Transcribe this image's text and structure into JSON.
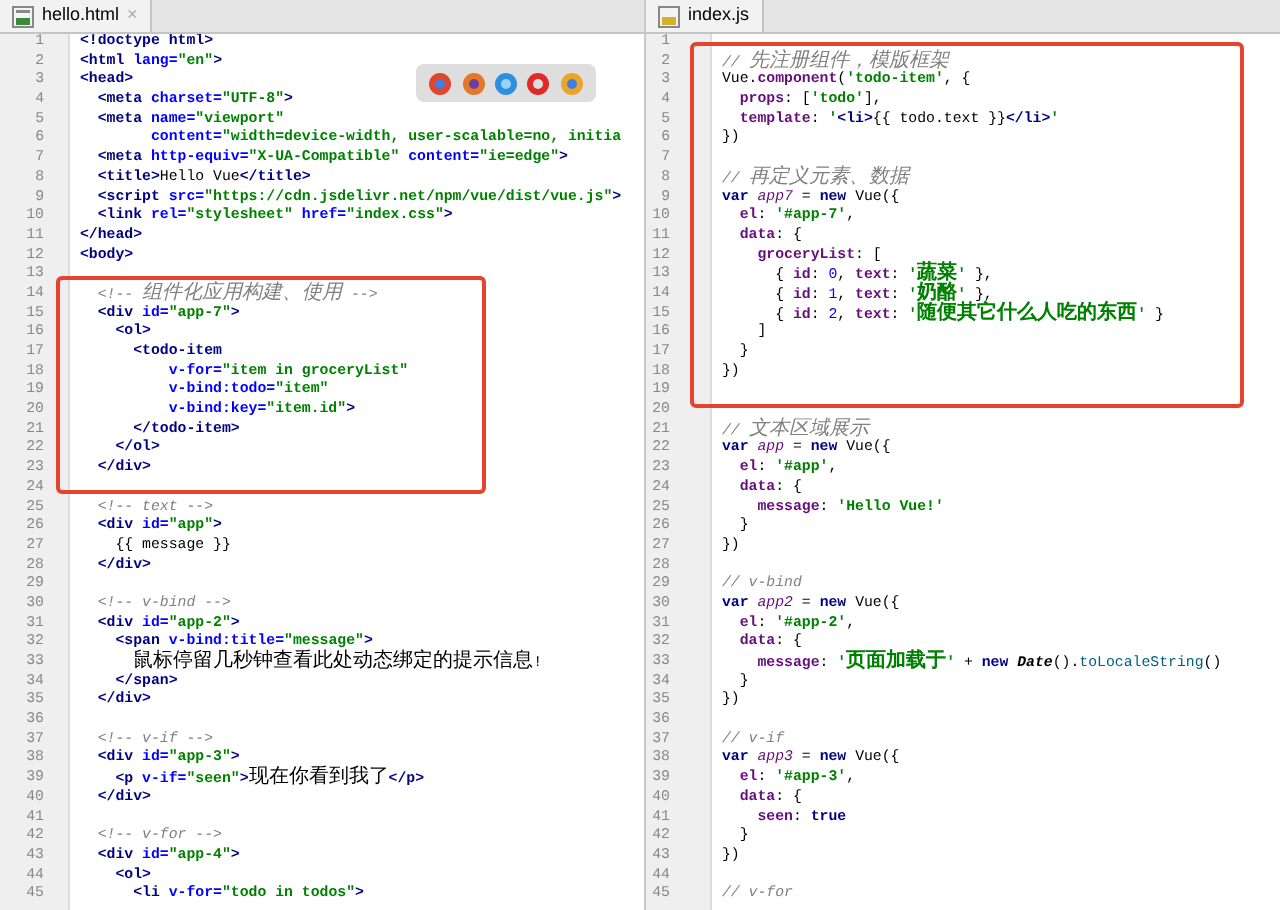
{
  "panes": [
    {
      "tab": {
        "kind": "html",
        "label": "hello.html",
        "close": "×"
      },
      "lines": [
        {
          "n": "1",
          "t": [
            {
              "kind": "tag",
              "text": "<!doctype html>"
            }
          ]
        },
        {
          "n": "2",
          "t": [
            {
              "kind": "tag",
              "text": "<html "
            },
            {
              "kind": "attr",
              "text": "lang="
            },
            {
              "kind": "str",
              "text": "\"en\""
            },
            {
              "kind": "tag",
              "text": ">"
            }
          ]
        },
        {
          "n": "3",
          "t": [
            {
              "kind": "tag",
              "text": "<head>"
            }
          ]
        },
        {
          "n": "4",
          "t": [
            {
              "kind": "tag",
              "text": "  <meta "
            },
            {
              "kind": "attr",
              "text": "charset="
            },
            {
              "kind": "str",
              "text": "\"UTF-8\""
            },
            {
              "kind": "tag",
              "text": ">"
            }
          ]
        },
        {
          "n": "5",
          "t": [
            {
              "kind": "tag",
              "text": "  <meta "
            },
            {
              "kind": "attr",
              "text": "name="
            },
            {
              "kind": "str",
              "text": "\"viewport\""
            }
          ]
        },
        {
          "n": "6",
          "t": [
            {
              "kind": "attr",
              "text": "        content="
            },
            {
              "kind": "str",
              "text": "\"width=device-width, user-scalable=no, initia"
            }
          ]
        },
        {
          "n": "7",
          "t": [
            {
              "kind": "tag",
              "text": "  <meta "
            },
            {
              "kind": "attr",
              "text": "http-equiv="
            },
            {
              "kind": "str",
              "text": "\"X-UA-Compatible\""
            },
            {
              "kind": "attr",
              "text": " content="
            },
            {
              "kind": "str",
              "text": "\"ie=edge\""
            },
            {
              "kind": "tag",
              "text": ">"
            }
          ]
        },
        {
          "n": "8",
          "t": [
            {
              "kind": "tag",
              "text": "  <title>"
            },
            {
              "kind": "plain",
              "text": "Hello Vue"
            },
            {
              "kind": "tag",
              "text": "</title>"
            }
          ]
        },
        {
          "n": "9",
          "t": [
            {
              "kind": "tag",
              "text": "  <script "
            },
            {
              "kind": "attr",
              "text": "src="
            },
            {
              "kind": "str",
              "text": "\"https://cdn.jsdelivr.net/npm/vue/dist/vue.js\""
            },
            {
              "kind": "tag",
              "text": ">"
            }
          ]
        },
        {
          "n": "10",
          "t": [
            {
              "kind": "tag",
              "text": "  <link "
            },
            {
              "kind": "attr",
              "text": "rel="
            },
            {
              "kind": "str",
              "text": "\"stylesheet\""
            },
            {
              "kind": "attr",
              "text": " href="
            },
            {
              "kind": "str",
              "text": "\"index.css\""
            },
            {
              "kind": "tag",
              "text": ">"
            }
          ]
        },
        {
          "n": "11",
          "t": [
            {
              "kind": "tag",
              "text": "</head>"
            }
          ]
        },
        {
          "n": "12",
          "t": [
            {
              "kind": "tag",
              "text": "<body>"
            }
          ]
        },
        {
          "n": "13"
        },
        {
          "n": "14",
          "t": [
            {
              "kind": "comment",
              "text": "  <!-- 组件化应用构建、使用 -->"
            }
          ]
        },
        {
          "n": "15",
          "t": [
            {
              "kind": "tag",
              "text": "  <div "
            },
            {
              "kind": "attr",
              "text": "id="
            },
            {
              "kind": "str",
              "text": "\"app-7\""
            },
            {
              "kind": "tag",
              "text": ">"
            }
          ]
        },
        {
          "n": "16",
          "t": [
            {
              "kind": "tag",
              "text": "    <ol>"
            }
          ]
        },
        {
          "n": "17",
          "t": [
            {
              "kind": "tag",
              "text": "      <todo-item"
            }
          ]
        },
        {
          "n": "18",
          "t": [
            {
              "kind": "attr",
              "text": "          v-for="
            },
            {
              "kind": "str",
              "text": "\"item in groceryList\""
            }
          ]
        },
        {
          "n": "19",
          "t": [
            {
              "kind": "attr",
              "text": "          v-bind:todo="
            },
            {
              "kind": "str",
              "text": "\"item\""
            }
          ]
        },
        {
          "n": "20",
          "t": [
            {
              "kind": "attr",
              "text": "          v-bind:key="
            },
            {
              "kind": "str",
              "text": "\"item.id\""
            },
            {
              "kind": "tag",
              "text": ">"
            }
          ]
        },
        {
          "n": "21",
          "t": [
            {
              "kind": "tag",
              "text": "      </todo-item>"
            }
          ]
        },
        {
          "n": "22",
          "t": [
            {
              "kind": "tag",
              "text": "    </ol>"
            }
          ]
        },
        {
          "n": "23",
          "t": [
            {
              "kind": "tag",
              "text": "  </div>"
            }
          ]
        },
        {
          "n": "24"
        },
        {
          "n": "25",
          "t": [
            {
              "kind": "comment",
              "text": "  <!-- text -->"
            }
          ]
        },
        {
          "n": "26",
          "t": [
            {
              "kind": "tag",
              "text": "  <div "
            },
            {
              "kind": "attr",
              "text": "id="
            },
            {
              "kind": "str",
              "text": "\"app\""
            },
            {
              "kind": "tag",
              "text": ">"
            }
          ]
        },
        {
          "n": "27",
          "t": [
            {
              "kind": "plain",
              "text": "    {{ message }}"
            }
          ]
        },
        {
          "n": "28",
          "t": [
            {
              "kind": "tag",
              "text": "  </div>"
            }
          ]
        },
        {
          "n": "29"
        },
        {
          "n": "30",
          "t": [
            {
              "kind": "comment",
              "text": "  <!-- v-bind -->"
            }
          ]
        },
        {
          "n": "31",
          "t": [
            {
              "kind": "tag",
              "text": "  <div "
            },
            {
              "kind": "attr",
              "text": "id="
            },
            {
              "kind": "str",
              "text": "\"app-2\""
            },
            {
              "kind": "tag",
              "text": ">"
            }
          ]
        },
        {
          "n": "32",
          "t": [
            {
              "kind": "tag",
              "text": "    <span "
            },
            {
              "kind": "attr",
              "text": "v-bind:title="
            },
            {
              "kind": "str",
              "text": "\"message\""
            },
            {
              "kind": "tag",
              "text": ">"
            }
          ]
        },
        {
          "n": "33",
          "t": [
            {
              "kind": "plain",
              "text": "      鼠标停留几秒钟查看此处动态绑定的提示信息!"
            }
          ]
        },
        {
          "n": "34",
          "t": [
            {
              "kind": "tag",
              "text": "    </span>"
            }
          ]
        },
        {
          "n": "35",
          "t": [
            {
              "kind": "tag",
              "text": "  </div>"
            }
          ]
        },
        {
          "n": "36"
        },
        {
          "n": "37",
          "t": [
            {
              "kind": "comment",
              "text": "  <!-- v-if -->"
            }
          ]
        },
        {
          "n": "38",
          "t": [
            {
              "kind": "tag",
              "text": "  <div "
            },
            {
              "kind": "attr",
              "text": "id="
            },
            {
              "kind": "str",
              "text": "\"app-3\""
            },
            {
              "kind": "tag",
              "text": ">"
            }
          ]
        },
        {
          "n": "39",
          "t": [
            {
              "kind": "tag",
              "text": "    <p "
            },
            {
              "kind": "attr",
              "text": "v-if="
            },
            {
              "kind": "str",
              "text": "\"seen\""
            },
            {
              "kind": "tag",
              "text": ">"
            },
            {
              "kind": "plain",
              "text": "现在你看到我了"
            },
            {
              "kind": "tag",
              "text": "</p>"
            }
          ]
        },
        {
          "n": "40",
          "t": [
            {
              "kind": "tag",
              "text": "  </div>"
            }
          ]
        },
        {
          "n": "41"
        },
        {
          "n": "42",
          "t": [
            {
              "kind": "comment",
              "text": "  <!-- v-for -->"
            }
          ]
        },
        {
          "n": "43",
          "t": [
            {
              "kind": "tag",
              "text": "  <div "
            },
            {
              "kind": "attr",
              "text": "id="
            },
            {
              "kind": "str",
              "text": "\"app-4\""
            },
            {
              "kind": "tag",
              "text": ">"
            }
          ]
        },
        {
          "n": "44",
          "t": [
            {
              "kind": "tag",
              "text": "    <ol>"
            }
          ]
        },
        {
          "n": "45",
          "t": [
            {
              "kind": "tag",
              "text": "      <li "
            },
            {
              "kind": "attr",
              "text": "v-for="
            },
            {
              "kind": "str",
              "text": "\"todo in todos\""
            },
            {
              "kind": "tag",
              "text": ">"
            }
          ]
        }
      ]
    },
    {
      "tab": {
        "kind": "js",
        "label": "index.js"
      },
      "lines": [
        {
          "n": "1"
        },
        {
          "n": "2",
          "t": [
            {
              "kind": "comment",
              "text": "// 先注册组件，模版框架"
            }
          ]
        },
        {
          "n": "3",
          "t": [
            {
              "kind": "plain",
              "text": "Vue."
            },
            {
              "kind": "prop",
              "text": "component"
            },
            {
              "kind": "plain",
              "text": "("
            },
            {
              "kind": "str",
              "text": "'todo-item'"
            },
            {
              "kind": "plain",
              "text": ", {"
            }
          ]
        },
        {
          "n": "4",
          "t": [
            {
              "kind": "prop",
              "text": "  props"
            },
            {
              "kind": "plain",
              "text": ": ["
            },
            {
              "kind": "str",
              "text": "'todo'"
            },
            {
              "kind": "plain",
              "text": "],"
            }
          ]
        },
        {
          "n": "5",
          "t": [
            {
              "kind": "prop",
              "text": "  template"
            },
            {
              "kind": "plain",
              "text": ": "
            },
            {
              "kind": "str",
              "text": "'"
            },
            {
              "kind": "tag",
              "text": "<li>"
            },
            {
              "kind": "plain",
              "text": "{{ todo.text }}"
            },
            {
              "kind": "tag",
              "text": "</li>"
            },
            {
              "kind": "str",
              "text": "'"
            }
          ]
        },
        {
          "n": "6",
          "t": [
            {
              "kind": "plain",
              "text": "})"
            }
          ]
        },
        {
          "n": "7"
        },
        {
          "n": "8",
          "t": [
            {
              "kind": "comment",
              "text": "// 再定义元素、数据"
            }
          ]
        },
        {
          "n": "9",
          "t": [
            {
              "kind": "keyword",
              "text": "var "
            },
            {
              "kind": "var",
              "text": "app7"
            },
            {
              "kind": "plain",
              "text": " = "
            },
            {
              "kind": "keyword",
              "text": "new "
            },
            {
              "kind": "plain",
              "text": "Vue({"
            }
          ]
        },
        {
          "n": "10",
          "t": [
            {
              "kind": "prop",
              "text": "  el"
            },
            {
              "kind": "plain",
              "text": ": "
            },
            {
              "kind": "str",
              "text": "'#app-7'"
            },
            {
              "kind": "plain",
              "text": ","
            }
          ]
        },
        {
          "n": "11",
          "t": [
            {
              "kind": "prop",
              "text": "  data"
            },
            {
              "kind": "plain",
              "text": ": {"
            }
          ]
        },
        {
          "n": "12",
          "t": [
            {
              "kind": "prop",
              "text": "    groceryList"
            },
            {
              "kind": "plain",
              "text": ": ["
            }
          ]
        },
        {
          "n": "13",
          "t": [
            {
              "kind": "plain",
              "text": "      { "
            },
            {
              "kind": "prop",
              "text": "id"
            },
            {
              "kind": "plain",
              "text": ": "
            },
            {
              "kind": "num",
              "text": "0"
            },
            {
              "kind": "plain",
              "text": ", "
            },
            {
              "kind": "prop",
              "text": "text"
            },
            {
              "kind": "plain",
              "text": ": "
            },
            {
              "kind": "str",
              "text": "'蔬菜'"
            },
            {
              "kind": "plain",
              "text": " },"
            }
          ]
        },
        {
          "n": "14",
          "t": [
            {
              "kind": "plain",
              "text": "      { "
            },
            {
              "kind": "prop",
              "text": "id"
            },
            {
              "kind": "plain",
              "text": ": "
            },
            {
              "kind": "num",
              "text": "1"
            },
            {
              "kind": "plain",
              "text": ", "
            },
            {
              "kind": "prop",
              "text": "text"
            },
            {
              "kind": "plain",
              "text": ": "
            },
            {
              "kind": "str",
              "text": "'奶酪'"
            },
            {
              "kind": "plain",
              "text": " },"
            }
          ]
        },
        {
          "n": "15",
          "t": [
            {
              "kind": "plain",
              "text": "      { "
            },
            {
              "kind": "prop",
              "text": "id"
            },
            {
              "kind": "plain",
              "text": ": "
            },
            {
              "kind": "num",
              "text": "2"
            },
            {
              "kind": "plain",
              "text": ", "
            },
            {
              "kind": "prop",
              "text": "text"
            },
            {
              "kind": "plain",
              "text": ": "
            },
            {
              "kind": "str",
              "text": "'随便其它什么人吃的东西'"
            },
            {
              "kind": "plain",
              "text": " }"
            }
          ]
        },
        {
          "n": "16",
          "t": [
            {
              "kind": "plain",
              "text": "    ]"
            }
          ]
        },
        {
          "n": "17",
          "t": [
            {
              "kind": "plain",
              "text": "  }"
            }
          ]
        },
        {
          "n": "18",
          "t": [
            {
              "kind": "plain",
              "text": "})"
            }
          ]
        },
        {
          "n": "19"
        },
        {
          "n": "20"
        },
        {
          "n": "21",
          "t": [
            {
              "kind": "comment",
              "text": "// 文本区域展示"
            }
          ]
        },
        {
          "n": "22",
          "t": [
            {
              "kind": "keyword",
              "text": "var "
            },
            {
              "kind": "var",
              "text": "app"
            },
            {
              "kind": "plain",
              "text": " = "
            },
            {
              "kind": "keyword",
              "text": "new "
            },
            {
              "kind": "plain",
              "text": "Vue({"
            }
          ]
        },
        {
          "n": "23",
          "t": [
            {
              "kind": "prop",
              "text": "  el"
            },
            {
              "kind": "plain",
              "text": ": "
            },
            {
              "kind": "str",
              "text": "'#app'"
            },
            {
              "kind": "plain",
              "text": ","
            }
          ]
        },
        {
          "n": "24",
          "t": [
            {
              "kind": "prop",
              "text": "  data"
            },
            {
              "kind": "plain",
              "text": ": {"
            }
          ]
        },
        {
          "n": "25",
          "t": [
            {
              "kind": "prop",
              "text": "    message"
            },
            {
              "kind": "plain",
              "text": ": "
            },
            {
              "kind": "str",
              "text": "'Hello Vue!'"
            }
          ]
        },
        {
          "n": "26",
          "t": [
            {
              "kind": "plain",
              "text": "  }"
            }
          ]
        },
        {
          "n": "27",
          "t": [
            {
              "kind": "plain",
              "text": "})"
            }
          ]
        },
        {
          "n": "28"
        },
        {
          "n": "29",
          "t": [
            {
              "kind": "comment",
              "text": "// v-bind"
            }
          ]
        },
        {
          "n": "30",
          "t": [
            {
              "kind": "keyword",
              "text": "var "
            },
            {
              "kind": "var",
              "text": "app2"
            },
            {
              "kind": "plain",
              "text": " = "
            },
            {
              "kind": "keyword",
              "text": "new "
            },
            {
              "kind": "plain",
              "text": "Vue({"
            }
          ]
        },
        {
          "n": "31",
          "t": [
            {
              "kind": "prop",
              "text": "  el"
            },
            {
              "kind": "plain",
              "text": ": "
            },
            {
              "kind": "str",
              "text": "'#app-2'"
            },
            {
              "kind": "plain",
              "text": ","
            }
          ]
        },
        {
          "n": "32",
          "t": [
            {
              "kind": "prop",
              "text": "  data"
            },
            {
              "kind": "plain",
              "text": ": {"
            }
          ]
        },
        {
          "n": "33",
          "t": [
            {
              "kind": "prop",
              "text": "    message"
            },
            {
              "kind": "plain",
              "text": ": "
            },
            {
              "kind": "str",
              "text": "'页面加载于'"
            },
            {
              "kind": "plain",
              "text": " + "
            },
            {
              "kind": "keyword",
              "text": "new "
            },
            {
              "kind": "class",
              "text": "Date"
            },
            {
              "kind": "plain",
              "text": "()."
            },
            {
              "kind": "method",
              "text": "toLocaleString"
            },
            {
              "kind": "plain",
              "text": "()"
            }
          ]
        },
        {
          "n": "34",
          "t": [
            {
              "kind": "plain",
              "text": "  }"
            }
          ]
        },
        {
          "n": "35",
          "t": [
            {
              "kind": "plain",
              "text": "})"
            }
          ]
        },
        {
          "n": "36"
        },
        {
          "n": "37",
          "t": [
            {
              "kind": "comment",
              "text": "// v-if"
            }
          ]
        },
        {
          "n": "38",
          "t": [
            {
              "kind": "keyword",
              "text": "var "
            },
            {
              "kind": "var",
              "text": "app3"
            },
            {
              "kind": "plain",
              "text": " = "
            },
            {
              "kind": "keyword",
              "text": "new "
            },
            {
              "kind": "plain",
              "text": "Vue({"
            }
          ]
        },
        {
          "n": "39",
          "t": [
            {
              "kind": "prop",
              "text": "  el"
            },
            {
              "kind": "plain",
              "text": ": "
            },
            {
              "kind": "str",
              "text": "'#app-3'"
            },
            {
              "kind": "plain",
              "text": ","
            }
          ]
        },
        {
          "n": "40",
          "t": [
            {
              "kind": "prop",
              "text": "  data"
            },
            {
              "kind": "plain",
              "text": ": {"
            }
          ]
        },
        {
          "n": "41",
          "t": [
            {
              "kind": "prop",
              "text": "    seen"
            },
            {
              "kind": "plain",
              "text": ": "
            },
            {
              "kind": "keyword",
              "text": "true"
            }
          ]
        },
        {
          "n": "42",
          "t": [
            {
              "kind": "plain",
              "text": "  }"
            }
          ]
        },
        {
          "n": "43",
          "t": [
            {
              "kind": "plain",
              "text": "})"
            }
          ]
        },
        {
          "n": "44"
        },
        {
          "n": "45",
          "t": [
            {
              "kind": "comment",
              "text": "// v-for"
            }
          ]
        }
      ]
    }
  ]
}
